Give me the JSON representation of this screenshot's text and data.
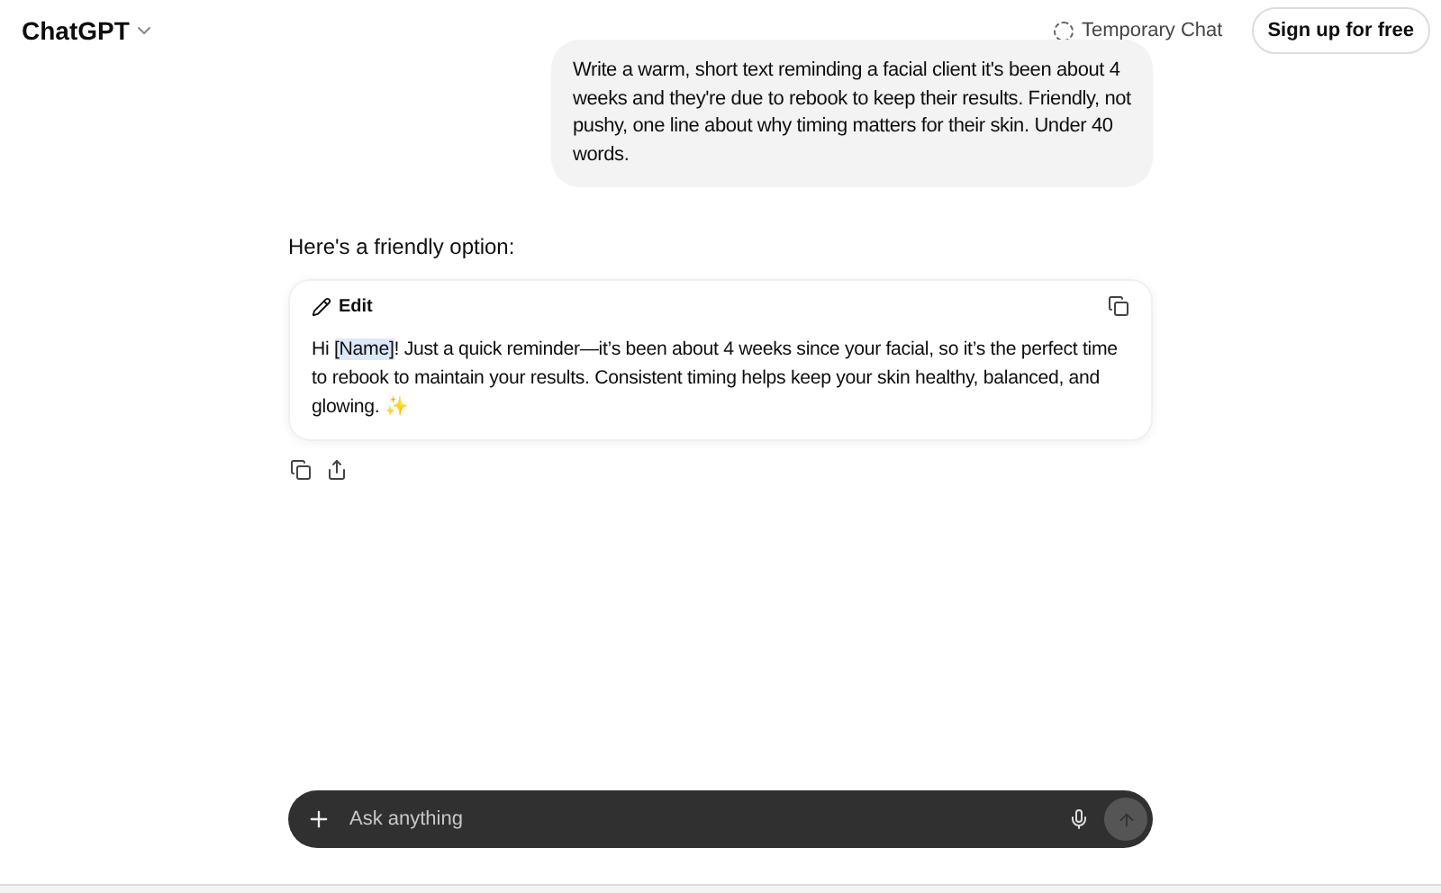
{
  "header": {
    "title": "ChatGPT",
    "temporary_chat": "Temporary Chat",
    "signup": "Sign up for free"
  },
  "user_message": "Write a warm, short text reminding a facial client it's been about 4 weeks and they're due to rebook to keep their results. Friendly, not pushy, one line about why timing matters for their skin. Under 40 words.",
  "assistant": {
    "intro": "Here's a friendly option:",
    "card": {
      "edit": "Edit",
      "parts": [
        {
          "text": "Hi ",
          "highlighted": false
        },
        {
          "text": "[Name]",
          "highlighted": true
        },
        {
          "text": "! Just a quick reminder—it’s been about 4 weeks since your facial, so it’s the perfect time to rebook to maintain your results. Consistent timing helps keep your skin healthy, balanced, and glowing. ✨",
          "highlighted": false
        }
      ]
    }
  },
  "composer": {
    "placeholder": "Ask anything"
  }
}
